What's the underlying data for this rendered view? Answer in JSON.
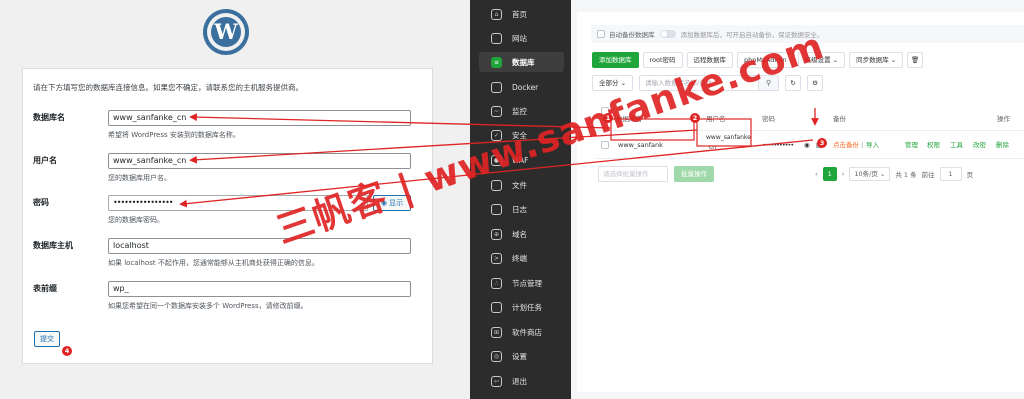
{
  "wordpress": {
    "logo_letter": "W",
    "intro": "请在下方填写您的数据库连接信息。如果您不确定，请联系您的主机服务提供商。",
    "fields": {
      "dbname": {
        "label": "数据库名",
        "value": "www_sanfanke_cn",
        "help": "希望将 WordPress 安装到的数据库名称。"
      },
      "username": {
        "label": "用户名",
        "value": "www_sanfanke_cn",
        "help": "您的数据库用户名。"
      },
      "password": {
        "label": "密码",
        "value": "••••••••••••••••",
        "help": "您的数据库密码。",
        "show_button": "显示"
      },
      "host": {
        "label": "数据库主机",
        "value": "localhost",
        "help": "如果 localhost 不起作用，您通常能够从主机商处获得正确的信息。"
      },
      "prefix": {
        "label": "表前缀",
        "value": "wp_",
        "help": "如果您希望在同一个数据库安装多个 WordPress，请修改前缀。"
      }
    },
    "submit": "提交"
  },
  "sidebar": {
    "items": [
      {
        "label": "首页",
        "icon": "home-icon"
      },
      {
        "label": "网站",
        "icon": "website-icon"
      },
      {
        "label": "数据库",
        "icon": "database-icon"
      },
      {
        "label": "Docker",
        "icon": "docker-icon"
      },
      {
        "label": "监控",
        "icon": "monitor-icon"
      },
      {
        "label": "安全",
        "icon": "shield-icon"
      },
      {
        "label": "WAF",
        "icon": "waf-icon"
      },
      {
        "label": "文件",
        "icon": "folder-icon"
      },
      {
        "label": "日志",
        "icon": "log-icon"
      },
      {
        "label": "域名",
        "icon": "globe-icon"
      },
      {
        "label": "终端",
        "icon": "terminal-icon"
      },
      {
        "label": "节点管理",
        "icon": "node-icon"
      },
      {
        "label": "计划任务",
        "icon": "clock-icon"
      },
      {
        "label": "软件商店",
        "icon": "store-icon"
      },
      {
        "label": "设置",
        "icon": "gear-icon"
      },
      {
        "label": "退出",
        "icon": "logout-icon"
      }
    ]
  },
  "bt": {
    "auto_backup_label": "自动备份数据库",
    "auto_backup_hint": "添加数据库后，可开启自动备份，保证数据安全。",
    "toolbar": {
      "add": "添加数据库",
      "root_pwd": "root密码",
      "remote": "远程数据库",
      "phpmyadmin": "phpMyAdmin",
      "advanced": "高级设置",
      "sync": "同步数据库",
      "delete_icon": "trash-icon"
    },
    "filter": {
      "category": "全部分",
      "search_placeholder": "请输入数据库名称/备注"
    },
    "table": {
      "headers": {
        "name": "数据库名",
        "user": "用户名",
        "password": "密码",
        "backup": "备份",
        "ops": "操作"
      },
      "row": {
        "name": "www_sanfank",
        "user_line1": "www_sanfanke",
        "user_line2": "_cn",
        "password": "•••••••••••",
        "backup_link": "点击备份",
        "import_link": "导入",
        "ops": [
          "管理",
          "权限",
          "工具",
          "改密",
          "删除"
        ]
      }
    },
    "bulk": {
      "select_placeholder": "请选择批量操作",
      "button": "批量操作"
    },
    "pager": {
      "current": "1",
      "page_size": "10条/页",
      "total": "共 1 条",
      "goto_label": "前往",
      "goto_value": "1",
      "page_suffix": "页"
    }
  },
  "annotations": {
    "badges": [
      "1",
      "2",
      "3",
      "4"
    ],
    "watermark": "三帆客 | www.sanfanke.com"
  }
}
